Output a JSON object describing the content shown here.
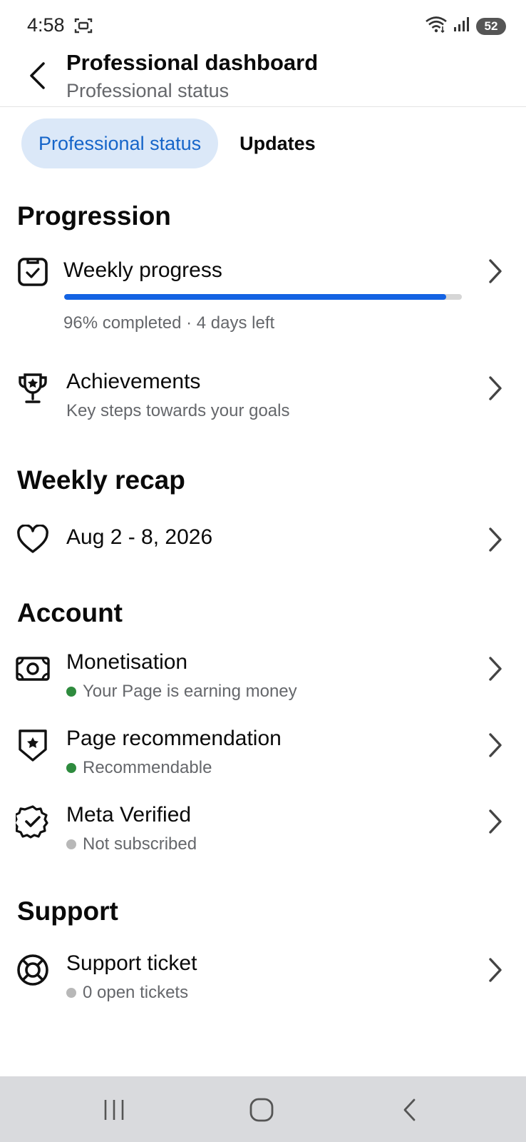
{
  "status_bar": {
    "time": "4:58",
    "battery": "52",
    "icons": [
      "screenshot-icon",
      "wifi-icon",
      "signal-icon",
      "battery-icon"
    ]
  },
  "header": {
    "title": "Professional dashboard",
    "subtitle": "Professional status"
  },
  "tabs": [
    {
      "label": "Professional status",
      "active": true
    },
    {
      "label": "Updates",
      "active": false
    }
  ],
  "sections": {
    "progression": {
      "title": "Progression",
      "weekly_progress": {
        "label": "Weekly progress",
        "progress_percent": 96,
        "status": "96% completed · 4 days left"
      },
      "achievements": {
        "label": "Achievements",
        "subtitle": "Key steps towards your goals"
      }
    },
    "weekly_recap": {
      "title": "Weekly recap",
      "date_range": "Aug 2 - 8, 2026"
    },
    "account": {
      "title": "Account",
      "monetisation": {
        "label": "Monetisation",
        "status": "Your Page is earning money",
        "status_color": "#2e8b3e"
      },
      "page_recommendation": {
        "label": "Page recommendation",
        "status": "Recommendable",
        "status_color": "#2e8b3e"
      },
      "meta_verified": {
        "label": "Meta Verified",
        "status": "Not subscribed",
        "status_color": "#b8b8b8"
      }
    },
    "support": {
      "title": "Support",
      "support_ticket": {
        "label": "Support ticket",
        "status": "0 open tickets",
        "status_color": "#b8b8b8"
      }
    }
  },
  "colors": {
    "accent": "#1463e3",
    "tab_active_bg": "#dbe8f8",
    "tab_active_text": "#1665c9",
    "nav_bar_bg": "#d9dadd"
  }
}
